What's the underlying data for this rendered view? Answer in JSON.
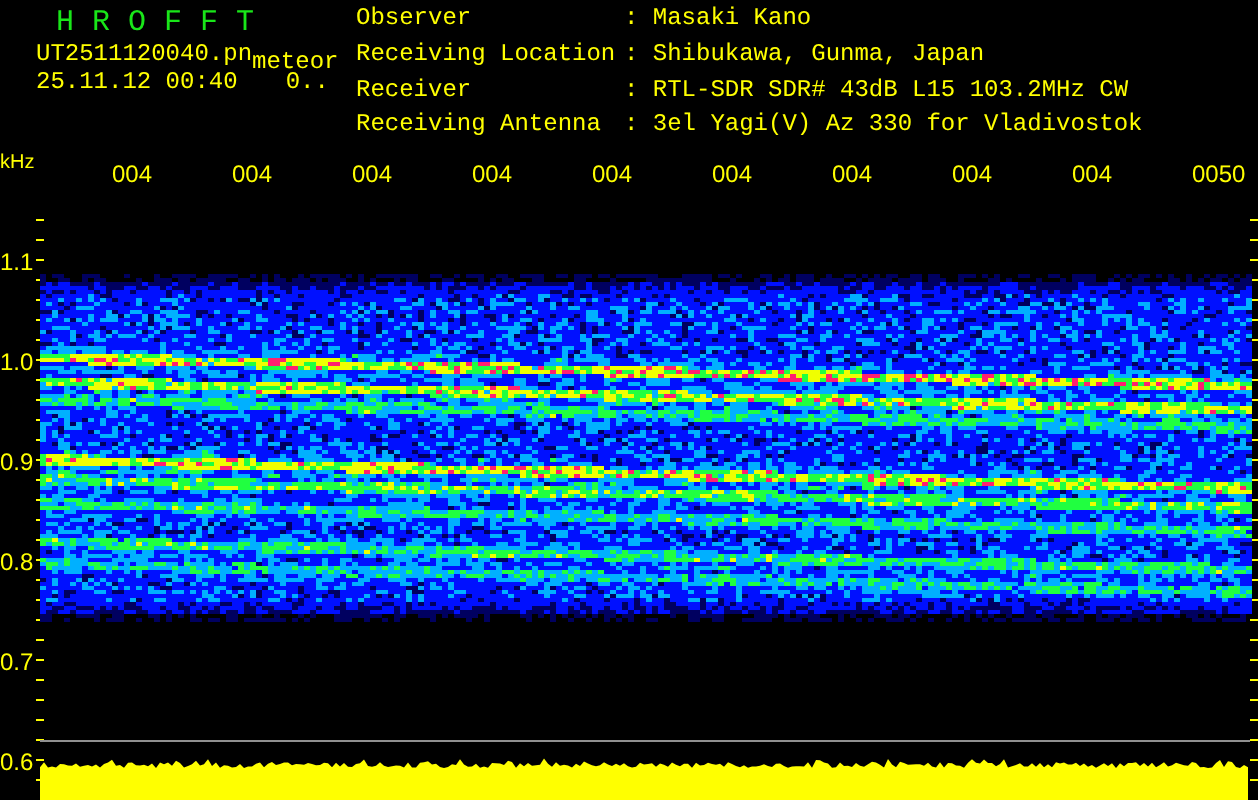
{
  "header": {
    "title": "H R O F F T",
    "file": "UT2511120040.pn",
    "mode": "meteor",
    "timestamp": "25.11.12 00:40",
    "counter": "0.."
  },
  "station_info": [
    {
      "label": "Observer",
      "value": ": Masaki Kano"
    },
    {
      "label": "Receiving Location",
      "value": ": Shibukawa, Gunma, Japan"
    },
    {
      "label": "Receiver",
      "value": ": RTL-SDR SDR# 43dB L15 103.2MHz CW"
    },
    {
      "label": "Receiving Antenna",
      "value": ": 3el Yagi(V) Az 330 for Vladivostok"
    }
  ],
  "spectrogram": {
    "unit": "kHz",
    "time_labels": [
      "004",
      "004",
      "004",
      "004",
      "004",
      "004",
      "004",
      "004",
      "004",
      "0050"
    ],
    "frequency_labels": [
      "1.1",
      "1.0",
      "0.9",
      "0.8",
      "0.7",
      "0.6"
    ]
  }
}
